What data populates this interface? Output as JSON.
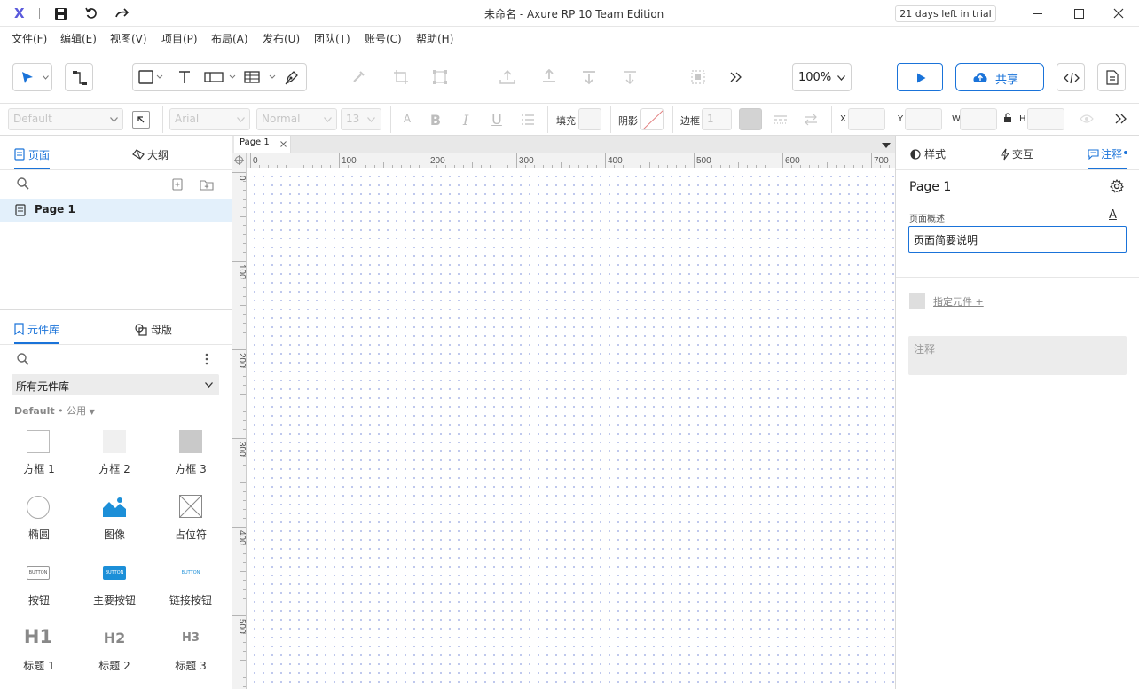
{
  "app": {
    "logo": "X",
    "title": "未命名 - Axure RP 10 Team Edition",
    "trial": "21 days left in trial"
  },
  "menu": [
    "文件(F)",
    "编辑(E)",
    "视图(V)",
    "项目(P)",
    "布局(A)",
    "发布(U)",
    "团队(T)",
    "账号(C)",
    "帮助(H)"
  ],
  "toolbar": {
    "zoom": "100%",
    "share_label": "共享"
  },
  "format": {
    "style": "Default",
    "font": "Arial",
    "weight": "Normal",
    "size": "13",
    "fill_label": "填充",
    "shadow_label": "阴影",
    "border_label": "边框",
    "border_value": "1",
    "x_label": "X",
    "y_label": "Y",
    "w_label": "W",
    "h_label": "H"
  },
  "left": {
    "tab_pages": "页面",
    "tab_outline": "大纲",
    "page_item": "Page 1",
    "tab_library": "元件库",
    "tab_masters": "母版",
    "library_select": "所有元件库",
    "library_name": "Default",
    "library_sep": "•",
    "library_sub": "公用",
    "widgets": [
      {
        "label": "方框 1"
      },
      {
        "label": "方框 2"
      },
      {
        "label": "方框 3"
      },
      {
        "label": "椭圆"
      },
      {
        "label": "图像"
      },
      {
        "label": "占位符"
      },
      {
        "label": "按钮",
        "inner": "BUTTON"
      },
      {
        "label": "主要按钮",
        "inner": "BUTTON"
      },
      {
        "label": "链接按钮",
        "inner": "BUTTON"
      },
      {
        "label": "标题 1",
        "inner": "H1"
      },
      {
        "label": "标题 2",
        "inner": "H2"
      },
      {
        "label": "标题 3",
        "inner": "H3"
      }
    ]
  },
  "canvas": {
    "tab": "Page 1",
    "ruler_top": [
      "0",
      "100",
      "200",
      "300",
      "400",
      "500",
      "600",
      "700"
    ],
    "ruler_left": [
      "0",
      "100",
      "200",
      "300",
      "400",
      "500"
    ]
  },
  "right": {
    "tab_style": "样式",
    "tab_interact": "交互",
    "tab_notes": "注释",
    "page_title": "Page 1",
    "desc_label": "页面概述",
    "desc_value": "页面简要说明",
    "assign_label": "指定元件 +",
    "notes_placeholder": "注释"
  },
  "colors": {
    "accent": "#1a73d9",
    "share_border": "#1a73d9",
    "selected_page_bg": "#e3f0fb"
  }
}
